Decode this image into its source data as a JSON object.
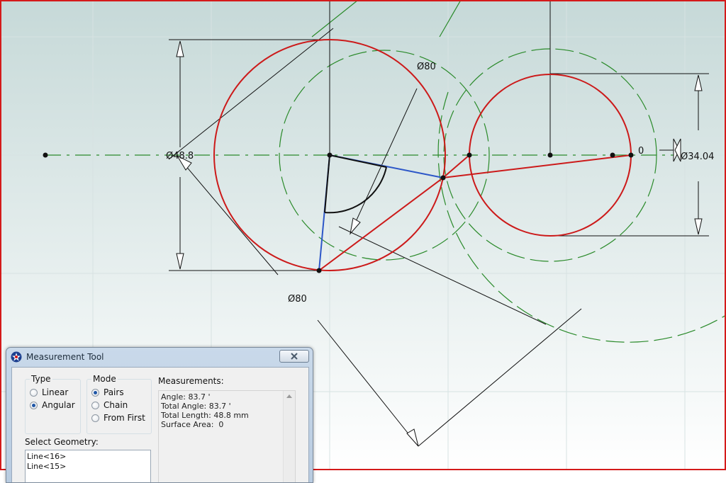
{
  "canvas": {
    "dimensions": {
      "top_left_diameter": "Ø80",
      "left_diameter": "Ø48.8",
      "bottom_diameter": "Ø80",
      "right_zero": "0",
      "right_diameter": "Ø34.04"
    },
    "colors": {
      "background_top": "#c6d9d8",
      "background_bottom": "#ffffff",
      "grid": "#d7e2e2",
      "centerline": "#2a8a2a",
      "circle": "#cc1a1a",
      "measure_line": "#2d57c8",
      "dimension": "#111111",
      "frame": "#d41a1a"
    }
  },
  "measurement_tool": {
    "title": "Measurement Tool",
    "icon": "star-logo-icon",
    "close_icon": "close-icon",
    "type": {
      "label": "Type",
      "options": [
        "Linear",
        "Angular"
      ],
      "selected": "Angular"
    },
    "mode": {
      "label": "Mode",
      "options": [
        "Pairs",
        "Chain",
        "From First"
      ],
      "selected": "Pairs"
    },
    "measurements": {
      "label": "Measurements:",
      "lines": [
        "Angle: 83.7 '",
        "Total Angle: 83.7 '",
        "Total Length: 48.8 mm",
        "Surface Area:  0"
      ]
    },
    "select_geometry": {
      "label": "Select Geometry:",
      "items": [
        "Line<16>",
        "Line<15>"
      ]
    }
  }
}
